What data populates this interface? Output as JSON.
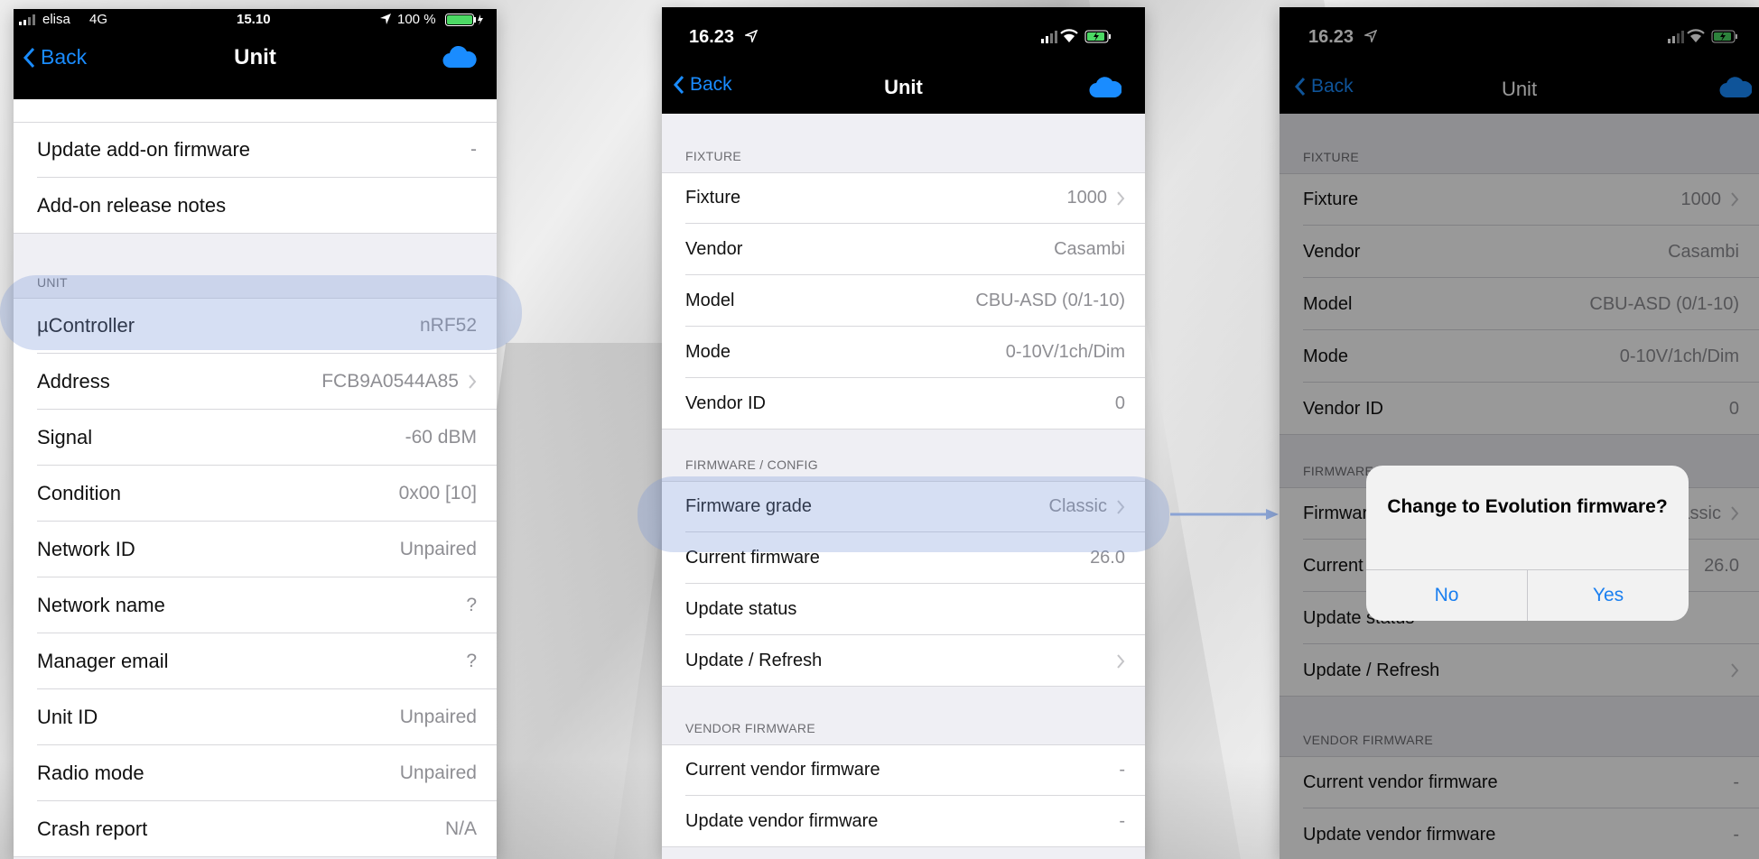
{
  "colors": {
    "accent": "#1a8cff",
    "highlight": "#7896d7",
    "nav_bg": "#000000",
    "group_bg": "#efeff4",
    "battery": "#4cd964"
  },
  "phone1": {
    "status": {
      "carrier": "elisa",
      "network": "4G",
      "time": "15.10",
      "battery": "100 %"
    },
    "nav": {
      "back": "Back",
      "title": "Unit"
    },
    "top_rows": [
      {
        "label": "Update add-on firmware",
        "value": "-"
      },
      {
        "label": "Add-on release notes",
        "value": ""
      }
    ],
    "unit_section": {
      "header": "UNIT"
    },
    "unit_rows": [
      {
        "label": "µController",
        "value": "nRF52"
      },
      {
        "label": "Address",
        "value": "FCB9A0544A85"
      },
      {
        "label": "Signal",
        "value": "-60 dBM"
      },
      {
        "label": "Condition",
        "value": "0x00 [10]"
      },
      {
        "label": "Network ID",
        "value": "Unpaired"
      },
      {
        "label": "Network name",
        "value": "?"
      },
      {
        "label": "Manager email",
        "value": "?"
      },
      {
        "label": "Unit ID",
        "value": "Unpaired"
      },
      {
        "label": "Radio mode",
        "value": "Unpaired"
      },
      {
        "label": "Crash report",
        "value": "N/A"
      }
    ]
  },
  "phone2": {
    "status": {
      "time": "16.23"
    },
    "nav": {
      "back": "Back",
      "title": "Unit"
    },
    "fixture_section": {
      "header": "FIXTURE",
      "rows": [
        {
          "label": "Fixture",
          "value": "1000"
        },
        {
          "label": "Vendor",
          "value": "Casambi"
        },
        {
          "label": "Model",
          "value": "CBU-ASD (0/1-10)"
        },
        {
          "label": "Mode",
          "value": "0-10V/1ch/Dim"
        },
        {
          "label": "Vendor ID",
          "value": "0"
        }
      ]
    },
    "firmware_section": {
      "header": "FIRMWARE / CONFIG",
      "rows": [
        {
          "label": "Firmware grade",
          "value": "Classic"
        },
        {
          "label": "Current firmware",
          "value": "26.0"
        },
        {
          "label": "Update status",
          "value": ""
        },
        {
          "label": "Update / Refresh",
          "value": ""
        }
      ]
    },
    "vendor_section": {
      "header": "VENDOR FIRMWARE",
      "rows": [
        {
          "label": "Current vendor firmware",
          "value": "-"
        },
        {
          "label": "Update vendor firmware",
          "value": "-"
        }
      ]
    }
  },
  "phone3": {
    "status": {
      "time": "16.23"
    },
    "nav": {
      "back": "Back",
      "title": "Unit"
    },
    "fixture_section": {
      "header": "FIXTURE",
      "rows": [
        {
          "label": "Fixture",
          "value": "1000"
        },
        {
          "label": "Vendor",
          "value": "Casambi"
        },
        {
          "label": "Model",
          "value": "CBU-ASD (0/1-10)"
        },
        {
          "label": "Mode",
          "value": "0-10V/1ch/Dim"
        },
        {
          "label": "Vendor ID",
          "value": "0"
        }
      ]
    },
    "firmware_section": {
      "header": "FIRMWARE / CONFIG",
      "rows": [
        {
          "label": "Firmware grade",
          "value": "Classic"
        },
        {
          "label": "Current firmware",
          "value": "26.0"
        },
        {
          "label": "Update status",
          "value": ""
        },
        {
          "label": "Update / Refresh",
          "value": ""
        }
      ]
    },
    "vendor_section": {
      "header": "VENDOR FIRMWARE",
      "rows": [
        {
          "label": "Current vendor firmware",
          "value": "-"
        },
        {
          "label": "Update vendor firmware",
          "value": "-"
        }
      ]
    },
    "alert": {
      "title": "Change to Evolution firmware?",
      "no": "No",
      "yes": "Yes"
    }
  }
}
